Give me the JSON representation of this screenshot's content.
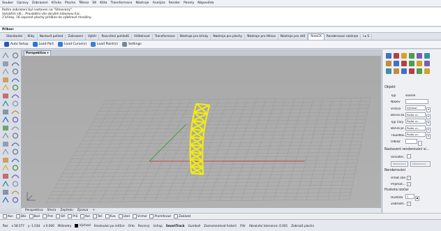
{
  "menu": [
    "Soubor",
    "Úpravy",
    "Zobrazení",
    "Křivka",
    "Plocha",
    "Těleso",
    "SK",
    "Kóta",
    "Transformace",
    "Nástroje",
    "Analýza",
    "Render",
    "Panely",
    "Nápověda"
  ],
  "history": [
    "Režim zobrazení byl nastaven na \"Stínovaný\".",
    "Vytvářím síti... Provádění vše skrytím klávesou Esc.",
    "2 křivky, 16 úsporné plochy přidáno do výběrové množiny."
  ],
  "command_prompt": "Příkaz:",
  "tabs": [
    "Standardní",
    "Kliky",
    "Nastavit pohled",
    "Zobrazení",
    "Výběr",
    "Rozvržení pohledů",
    "Viditelnost",
    "Transformace",
    "Nástroje pro křivky",
    "Nástroje pro plochy",
    "Nástroje pro tělesa",
    "Nástroje pro sítě",
    "RotoCK",
    "Renderovací nástroje",
    "I ▸ S"
  ],
  "active_tab_index": 12,
  "toolbar2": [
    {
      "label": "Auto Setup",
      "icon": "auto-setup-icon",
      "color": "#1f5bb5"
    },
    {
      "label": "Load Part",
      "icon": "load-part-icon",
      "color": "#2a72d6"
    },
    {
      "label": "Load Curve(s)",
      "icon": "load-curves-icon",
      "color": "#3b7ad8"
    },
    {
      "label": "Load Point(s)",
      "icon": "load-points-icon",
      "color": "#3b7ad8"
    },
    {
      "label": "Settings",
      "icon": "gear-icon",
      "color": "#7a8799"
    }
  ],
  "viewport": {
    "title": "Perspektiva",
    "dropdown": "▾"
  },
  "viewport_tabs": [
    "Perspektiva",
    "Shora",
    "Zepředu",
    "Zprava",
    "+"
  ],
  "properties": {
    "header": "Objekt",
    "rows": [
      {
        "label": "Typ",
        "value": "sloené"
      },
      {
        "label": "Název",
        "value": ""
      },
      {
        "label": "Vrstva",
        "value": "Výchozí"
      },
      {
        "label": "Barva zo...",
        "value": "Podle vr..."
      },
      {
        "label": "Typ čáry",
        "value": "Podle vr..."
      },
      {
        "label": "Barva pr...",
        "value": "Podle vr..."
      },
      {
        "label": "Tloušťka...",
        "value": "Podle vr..."
      },
      {
        "label": "Odkaz",
        "value": ""
      }
    ],
    "render_header": "Nastavení renderování sí...",
    "uzivatel": "Uživatel...",
    "nastaveni_btn": "Nastavení",
    "nastaveni_btn2": "Nastaveni...",
    "rendering_header": "Renderování",
    "vrhat_stiny": "Vrhat stíny",
    "prijimat": "Přijímat...",
    "isocurve_header": "Hustota izočar",
    "hustota_label": "Hustota",
    "hustota_value": "1",
    "zobrazit": "Zobrazit..."
  },
  "osnap": [
    "Kon",
    "Blíz",
    "Bod",
    "Prst",
    "Stř",
    "Prů",
    "Kol",
    "Teč",
    "Kva",
    "Uzel",
    "Vrchol",
    "Promítnout",
    "Zakázat"
  ],
  "status": {
    "view_label": "Řez",
    "x": "x 58.577",
    "y": "y -1.034",
    "z": "z 0.000",
    "units": "Milimetry",
    "layer": "Výchozí",
    "items": [
      "Kreslování po mřížce",
      "Orto",
      "Rovinný",
      "Uchop",
      "SmartTrack",
      "Gumball",
      "Zaznamenávat historii",
      "Filtr",
      "Absolutní tolerance: 0.001",
      "Zobrazit plocha"
    ]
  },
  "colors": {
    "truss": "#f2ea12",
    "x_axis": "#c24a44",
    "y_axis": "#3aa14a"
  }
}
